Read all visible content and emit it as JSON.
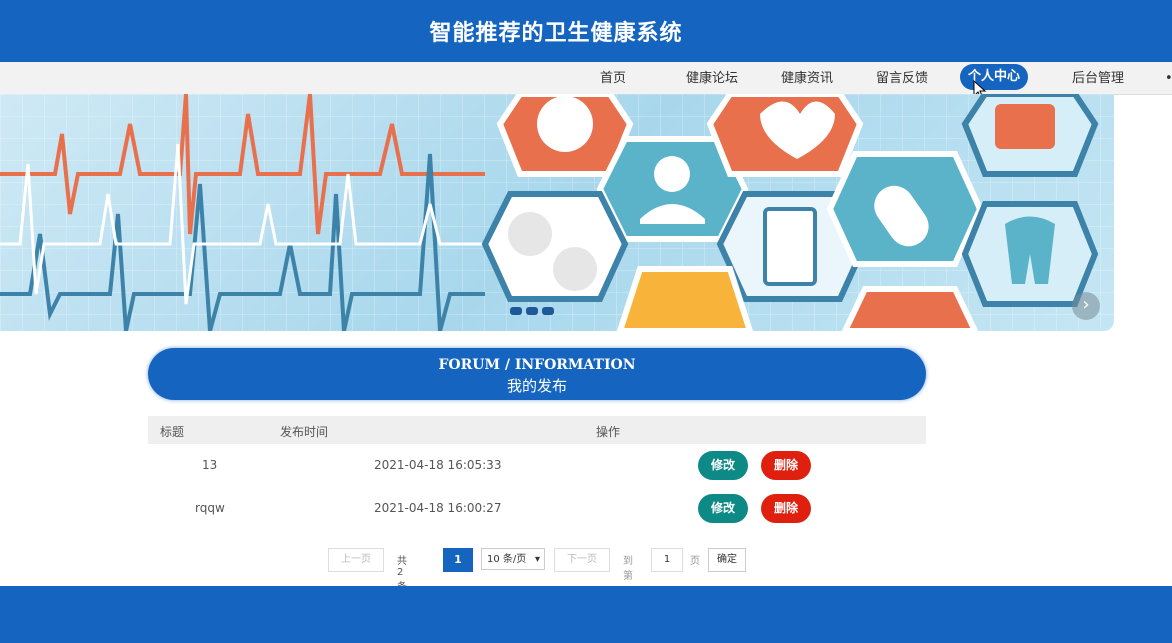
{
  "header": {
    "title": "智能推荐的卫生健康系统"
  },
  "nav": {
    "items": [
      {
        "label": "首页"
      },
      {
        "label": "健康论坛"
      },
      {
        "label": "健康资讯"
      },
      {
        "label": "留言反馈"
      },
      {
        "label": "个人中心",
        "active": true
      },
      {
        "label": "后台管理"
      }
    ]
  },
  "section": {
    "title_en": "FORUM / INFORMATION",
    "title_cn": "我的发布"
  },
  "table": {
    "headers": [
      "标题",
      "发布时间",
      "操作"
    ],
    "rows": [
      {
        "title": "13",
        "time": "2021-04-18 16:05:33",
        "edit": "修改",
        "delete": "删除"
      },
      {
        "title": "rqqw",
        "time": "2021-04-18 16:00:27",
        "edit": "修改",
        "delete": "删除"
      }
    ]
  },
  "pager": {
    "prev": "上一页",
    "total": "共 2 条",
    "current": "1",
    "page_size": "10 条/页",
    "next": "下一页",
    "goto": "到第",
    "goto_value": "1",
    "page_unit": "页",
    "confirm": "确定"
  },
  "colors": {
    "primary": "#1565c0",
    "edit": "#0d8a86",
    "delete": "#e0200f"
  }
}
